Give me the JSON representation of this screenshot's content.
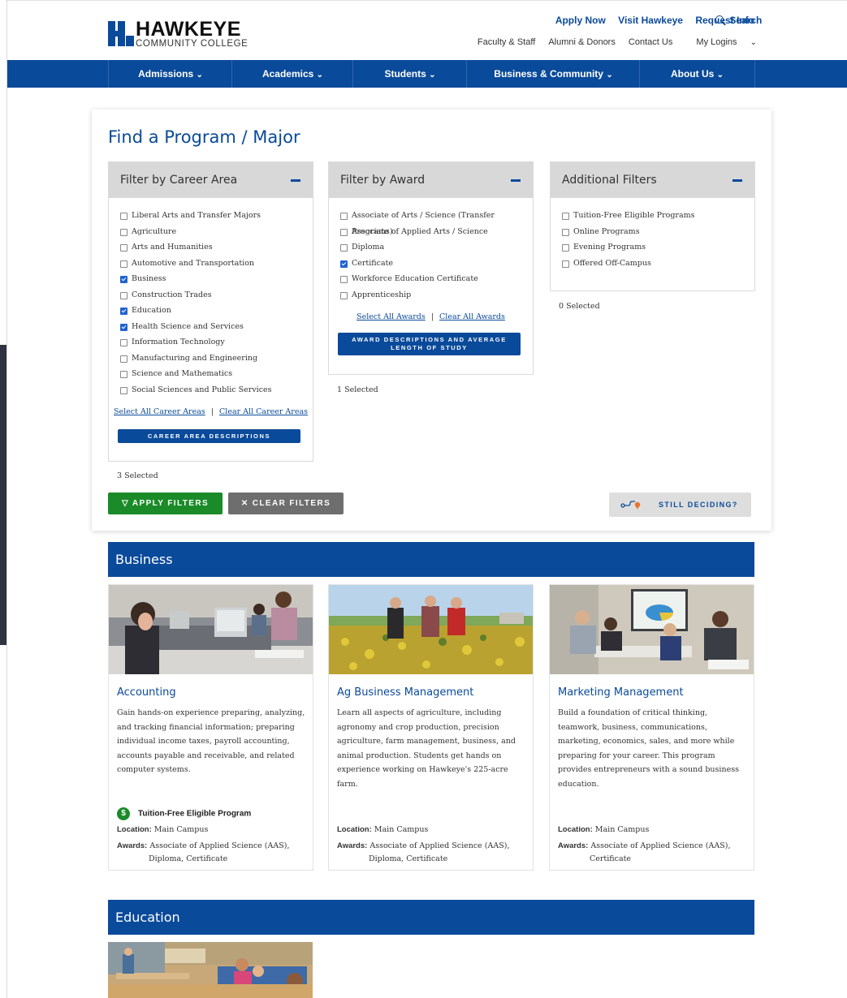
{
  "logo": {
    "name": "HAWKEYE",
    "sub": "COMMUNITY COLLEGE"
  },
  "top_links": [
    "Apply Now",
    "Visit Hawkeye",
    "Request Info"
  ],
  "search_label": "Search",
  "sub_links": [
    "Faculty & Staff",
    "Alumni & Donors",
    "Contact Us",
    "My Logins"
  ],
  "nav": [
    "Admissions",
    "Academics",
    "Students",
    "Business & Community",
    "About Us"
  ],
  "finder": {
    "title": "Find a Program / Major",
    "career_panel": {
      "title": "Filter by Career Area",
      "options": [
        {
          "label": "Liberal Arts and Transfer Majors",
          "checked": false
        },
        {
          "label": "Agriculture",
          "checked": false
        },
        {
          "label": "Arts and Humanities",
          "checked": false
        },
        {
          "label": "Automotive and Transportation",
          "checked": false
        },
        {
          "label": "Business",
          "checked": true
        },
        {
          "label": "Construction Trades",
          "checked": false
        },
        {
          "label": "Education",
          "checked": true
        },
        {
          "label": "Health Science and Services",
          "checked": true
        },
        {
          "label": "Information Technology",
          "checked": false
        },
        {
          "label": "Manufacturing and Engineering",
          "checked": false
        },
        {
          "label": "Science and Mathematics",
          "checked": false
        },
        {
          "label": "Social Sciences and Public Services",
          "checked": false
        }
      ],
      "select_all": "Select All Career Areas",
      "clear_all": "Clear All Career Areas",
      "separator": "|",
      "button": "CAREER AREA DESCRIPTIONS",
      "selected": "3 Selected"
    },
    "award_panel": {
      "title": "Filter by Award",
      "options": [
        {
          "label": "Associate of Arts / Science (Transfer Programs)",
          "checked": false
        },
        {
          "label": "Associate of Applied Arts / Science",
          "checked": false
        },
        {
          "label": "Diploma",
          "checked": false
        },
        {
          "label": "Certificate",
          "checked": true
        },
        {
          "label": "Workforce Education Certificate",
          "checked": false
        },
        {
          "label": "Apprenticeship",
          "checked": false
        }
      ],
      "select_all": "Select All Awards",
      "clear_all": "Clear All Awards",
      "separator": "|",
      "button": "AWARD DESCRIPTIONS AND AVERAGE LENGTH OF STUDY",
      "selected": "1 Selected"
    },
    "additional_panel": {
      "title": "Additional Filters",
      "options": [
        {
          "label": "Tuition-Free Eligible Programs",
          "checked": false
        },
        {
          "label": "Online Programs",
          "checked": false
        },
        {
          "label": "Evening Programs",
          "checked": false
        },
        {
          "label": "Offered Off-Campus",
          "checked": false
        }
      ],
      "selected": "0 Selected"
    },
    "apply_label": "APPLY FILTERS",
    "clear_label": "CLEAR FILTERS",
    "deciding_label": "STILL DECIDING?"
  },
  "sections": [
    {
      "title": "Business",
      "programs": [
        {
          "title": "Accounting",
          "desc": "Gain hands-on experience preparing, analyzing, and tracking financial information; preparing individual income taxes, payroll accounting, accounts payable and receivable, and related computer systems.",
          "tuition": "Tuition-Free Eligible Program",
          "location_label": "Location:",
          "location": "Main Campus",
          "awards_label": "Awards:",
          "awards_line1": "Associate of Applied Science (AAS),",
          "awards_line2": "Diploma, Certificate"
        },
        {
          "title": "Ag Business Management",
          "desc": "Learn all aspects of agriculture, including agronomy and crop production, precision agriculture, farm management, business, and animal production. Students get hands on experience working on Hawkeye's 225-acre farm.",
          "location_label": "Location:",
          "location": "Main Campus",
          "awards_label": "Awards:",
          "awards_line1": "Associate of Applied Science (AAS),",
          "awards_line2": "Diploma, Certificate"
        },
        {
          "title": "Marketing Management",
          "desc": "Build a foundation of critical thinking, teamwork, business, communications, marketing, economics, sales, and more while preparing for your career. This program provides entrepreneurs with a sound business education.",
          "location_label": "Location:",
          "location": "Main Campus",
          "awards_label": "Awards:",
          "awards_line1": "Associate of Applied Science (AAS),",
          "awards_line2": "Certificate"
        }
      ]
    },
    {
      "title": "Education"
    }
  ],
  "colors": {
    "brand_blue": "#0a4a9a",
    "apply_green": "#1a8b28",
    "clear_gray": "#6e6e6e"
  }
}
